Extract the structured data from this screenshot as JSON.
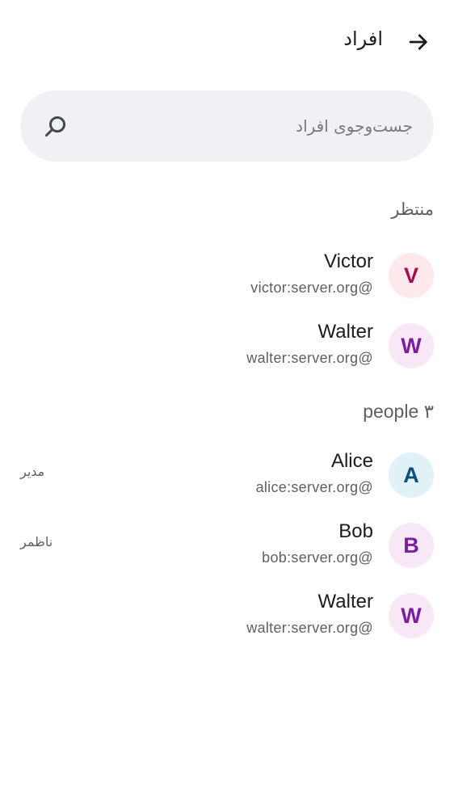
{
  "header": {
    "title": "افراد",
    "back_icon": "arrow-right-icon"
  },
  "search": {
    "placeholder": "جست‌وجوی افراد",
    "value": ""
  },
  "sections": {
    "pending": {
      "label": "منتظر",
      "members": [
        {
          "initial": "V",
          "name": "Victor",
          "id": "victor:server.org@",
          "role": "",
          "bg": "#fde8ec",
          "fg": "#a0104c"
        },
        {
          "initial": "W",
          "name": "Walter",
          "id": "walter:server.org@",
          "role": "",
          "bg": "#f8e8f6",
          "fg": "#7b1ea2"
        }
      ]
    },
    "joined": {
      "label": "people ۳",
      "members": [
        {
          "initial": "A",
          "name": "Alice",
          "id": "alice:server.org@",
          "role": "مدیر",
          "bg": "#e0f1f7",
          "fg": "#0b4f7a"
        },
        {
          "initial": "B",
          "name": "Bob",
          "id": "bob:server.org@",
          "role": "ناظمر",
          "bg": "#f8e8f6",
          "fg": "#7b1ea2"
        },
        {
          "initial": "W",
          "name": "Walter",
          "id": "walter:server.org@",
          "role": "",
          "bg": "#f8e8f6",
          "fg": "#7b1ea2"
        }
      ]
    }
  }
}
